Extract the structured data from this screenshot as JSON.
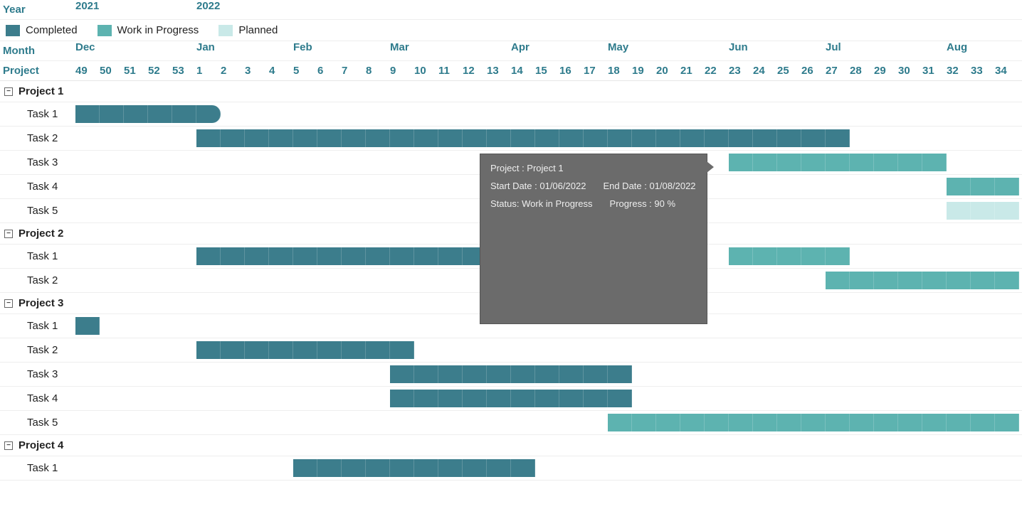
{
  "labels": {
    "year": "Year",
    "month": "Month",
    "project": "Project"
  },
  "legend": [
    {
      "label": "Completed",
      "cls": "c-completed"
    },
    {
      "label": "Work in Progress",
      "cls": "c-wip"
    },
    {
      "label": "Planned",
      "cls": "c-planned"
    }
  ],
  "years": [
    {
      "label": "2021",
      "pos": 0
    },
    {
      "label": "2022",
      "pos": 5
    }
  ],
  "months": [
    {
      "label": "Dec",
      "pos": 0
    },
    {
      "label": "Jan",
      "pos": 5
    },
    {
      "label": "Feb",
      "pos": 9
    },
    {
      "label": "Mar",
      "pos": 13
    },
    {
      "label": "Apr",
      "pos": 18
    },
    {
      "label": "May",
      "pos": 22
    },
    {
      "label": "Jun",
      "pos": 27
    },
    {
      "label": "Jul",
      "pos": 31
    },
    {
      "label": "Aug",
      "pos": 36
    }
  ],
  "weeks": [
    "49",
    "50",
    "51",
    "52",
    "53",
    "1",
    "2",
    "3",
    "4",
    "5",
    "6",
    "7",
    "8",
    "9",
    "10",
    "11",
    "12",
    "13",
    "14",
    "15",
    "16",
    "17",
    "18",
    "19",
    "20",
    "21",
    "22",
    "23",
    "24",
    "25",
    "26",
    "27",
    "28",
    "29",
    "30",
    "31",
    "32",
    "33",
    "34"
  ],
  "tooltip": {
    "project_line": "Project : Project 1",
    "start_line": "Start Date : 01/06/2022",
    "end_line": "End Date : 01/08/2022",
    "status_line": "Status: Work in Progress",
    "progress_line": "Progress : 90 %"
  },
  "chart_data": {
    "type": "gantt",
    "time_axis_unit": "iso_week",
    "week_range_start": "2021-W49",
    "week_range_end": "2022-W34",
    "statuses": {
      "completed": {
        "color": "#3c7d8c",
        "label": "Completed"
      },
      "wip": {
        "color": "#5db3b0",
        "label": "Work in Progress"
      },
      "planned": {
        "color": "#c9e9e8",
        "label": "Planned"
      }
    },
    "projects": [
      {
        "name": "Project 1",
        "tasks": [
          {
            "name": "Task 1",
            "start_idx": 0,
            "len": 6,
            "status": "completed",
            "rounded_end": true
          },
          {
            "name": "Task 2",
            "start_idx": 5,
            "len": 27,
            "status": "completed"
          },
          {
            "name": "Task 3",
            "segments": [
              {
                "start_idx": 27,
                "len": 9,
                "status": "wip"
              }
            ],
            "tooltip_target": true
          },
          {
            "name": "Task 4",
            "start_idx": 36,
            "len": 3,
            "status": "wip",
            "extends_right": true
          },
          {
            "name": "Task 5",
            "start_idx": 36,
            "len": 3,
            "status": "planned",
            "extends_right": true
          }
        ]
      },
      {
        "name": "Project 2",
        "tasks": [
          {
            "name": "Task 1",
            "segments": [
              {
                "start_idx": 5,
                "len": 13,
                "status": "completed"
              },
              {
                "start_idx": 27,
                "len": 5,
                "status": "wip"
              }
            ]
          },
          {
            "name": "Task 2",
            "start_idx": 31,
            "len": 8,
            "status": "wip",
            "extends_right": true
          }
        ]
      },
      {
        "name": "Project 3",
        "tasks": [
          {
            "name": "Task 1",
            "start_idx": 0,
            "len": 1,
            "status": "completed"
          },
          {
            "name": "Task 2",
            "start_idx": 5,
            "len": 9,
            "status": "completed"
          },
          {
            "name": "Task 3",
            "start_idx": 13,
            "len": 10,
            "status": "completed"
          },
          {
            "name": "Task 4",
            "start_idx": 13,
            "len": 10,
            "status": "completed"
          },
          {
            "name": "Task 5",
            "start_idx": 22,
            "len": 17,
            "status": "wip",
            "extends_right": true
          }
        ]
      },
      {
        "name": "Project 4",
        "tasks": [
          {
            "name": "Task 1",
            "start_idx": 9,
            "len": 10,
            "status": "completed"
          }
        ]
      }
    ]
  }
}
